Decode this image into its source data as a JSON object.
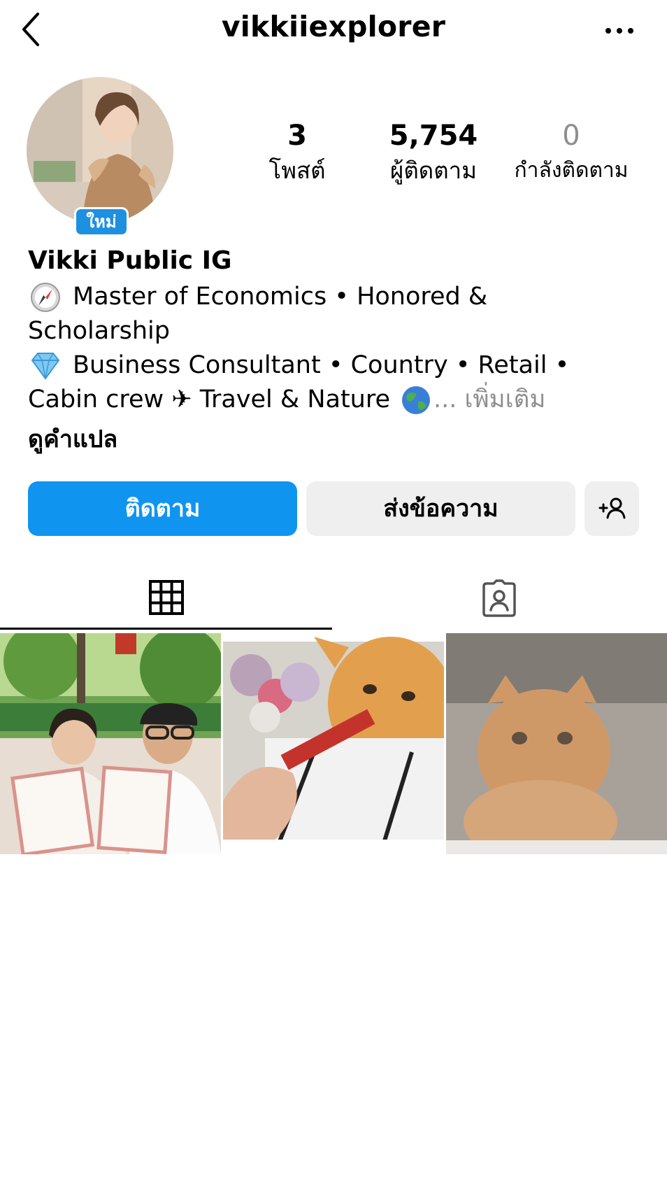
{
  "header": {
    "username": "vikkiiexplorer",
    "back_icon": "chevron-left-icon",
    "more_icon": "more-horizontal-icon"
  },
  "profile": {
    "new_badge": "ใหม่",
    "display_name": "Vikki Public IG",
    "bio_line1": "Master of Economics • Honored &",
    "bio_line1_emoji": "compass-emoji",
    "bio_line2": "Scholarship",
    "bio_line3": "Business Consultant • Country • Retail •",
    "bio_line3_emoji": "gem-emoji",
    "bio_line4": "Cabin crew ✈ Travel & Nature",
    "bio_line4_emoji": "globe-emoji",
    "bio_more": "... เพิ่มเติม",
    "translate_link": "ดูคำแปล"
  },
  "stats": {
    "posts_count": "3",
    "posts_label": "โพสต์",
    "followers_count": "5,754",
    "followers_label": "ผู้ติดตาม",
    "following_count": "0",
    "following_label": "กำลังติดตาม"
  },
  "actions": {
    "follow_label": "ติดตาม",
    "message_label": "ส่งข้อความ",
    "add_user_icon": "add-person-icon"
  },
  "tabs": [
    {
      "name": "posts-grid",
      "icon": "grid-icon",
      "selected": true
    },
    {
      "name": "tagged",
      "icon": "tagged-person-icon",
      "selected": false
    }
  ],
  "colors": {
    "follow_button": "#0f95f0",
    "secondary_button": "#efefef",
    "new_badge": "#1e90e0",
    "muted_text": "#8e8e8e"
  }
}
